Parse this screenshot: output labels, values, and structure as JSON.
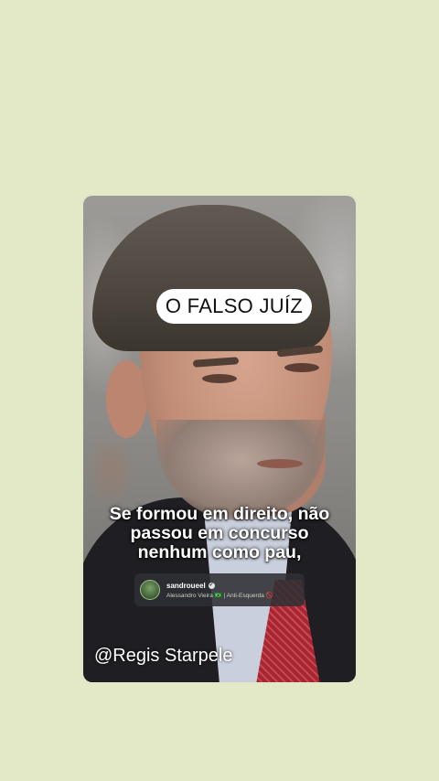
{
  "post": {
    "title": "O FALSO JUÍZ",
    "caption_lines": [
      "Se formou em direito, não",
      "passou em concurso",
      "nenhum como pau,"
    ],
    "profile": {
      "username": "sandroueel",
      "bio": "Alessandro Vieira 🇧🇷 | Anti-Esquerda 🚫"
    },
    "watermark": "@Regis Starpele"
  },
  "colors": {
    "page_background": "#e3e9c6",
    "pill_background": "#ffffff",
    "caption_text": "#ffffff"
  },
  "icons": {
    "verified": "verified-badge-icon",
    "avatar": "profile-avatar"
  }
}
